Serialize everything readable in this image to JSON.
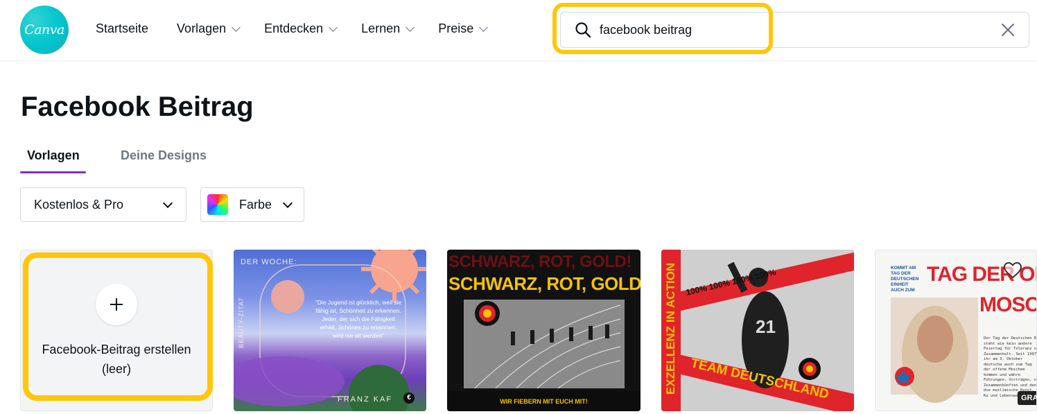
{
  "brand": {
    "logo_text": "Canva",
    "accent": "#7d2ae8",
    "highlight": "#ffc60a",
    "logo_color": "#00c4cc"
  },
  "nav": {
    "items": [
      {
        "label": "Startseite",
        "has_dropdown": false
      },
      {
        "label": "Vorlagen",
        "has_dropdown": true
      },
      {
        "label": "Entdecken",
        "has_dropdown": true
      },
      {
        "label": "Lernen",
        "has_dropdown": true
      },
      {
        "label": "Preise",
        "has_dropdown": true
      }
    ]
  },
  "search": {
    "value": "facebook beitrag",
    "icon": "search-icon",
    "clear_icon": "close-icon"
  },
  "page": {
    "title": "Facebook Beitrag"
  },
  "tabs": [
    {
      "label": "Vorlagen",
      "active": true
    },
    {
      "label": "Deine Designs",
      "active": false
    }
  ],
  "filters": {
    "license": {
      "label": "Kostenlos & Pro"
    },
    "color": {
      "label": "Farbe"
    }
  },
  "create_card": {
    "label": "Facebook-Beitrag erstellen (leer)"
  },
  "templates": [
    {
      "header": "DER WOCHE:",
      "side": "BEAUTY-ZITAT",
      "quote": "\"Die Jugend ist glücklich, weil sie fähig ist, Schönheit zu erkennen. Jeder, der sich die Fähigkeit erhält, Schönes zu erkennen, wird nie alt werden\"",
      "author": "FRANZ KAF",
      "badge": "€"
    },
    {
      "headline_top": "SCHWARZ, ROT, GOLD!",
      "headline": "SCHWARZ, ROT, GOLD!",
      "footer": "WIR FIEBERN MIT EUCH MIT!"
    },
    {
      "side": "EXZELLENZ IN ACTION",
      "band": "100% 100% 100% 100%",
      "jersey": "21",
      "bottom": "TEAM DEUTSCHLAND"
    },
    {
      "small_heading": "KOMMT AM TAG DER DEUTSCHEN EINHEIT AUCH ZUM",
      "headline_1": "TAG DER OFFEN",
      "headline_2": "MOSCHE",
      "body": "Der Tag der Deutschen E steht wie kein andere Feiertag für Toleranz u Zusammenhalt. Seit 1997 ihr am 3. Oktober deutscha auch zum Tag der offene Moschee kommen und währe Führungen, Vorträgen, ne Zusammenkünften und den die muslimische Kunst, Ku und Lebensweise",
      "badge": "GRA"
    }
  ]
}
